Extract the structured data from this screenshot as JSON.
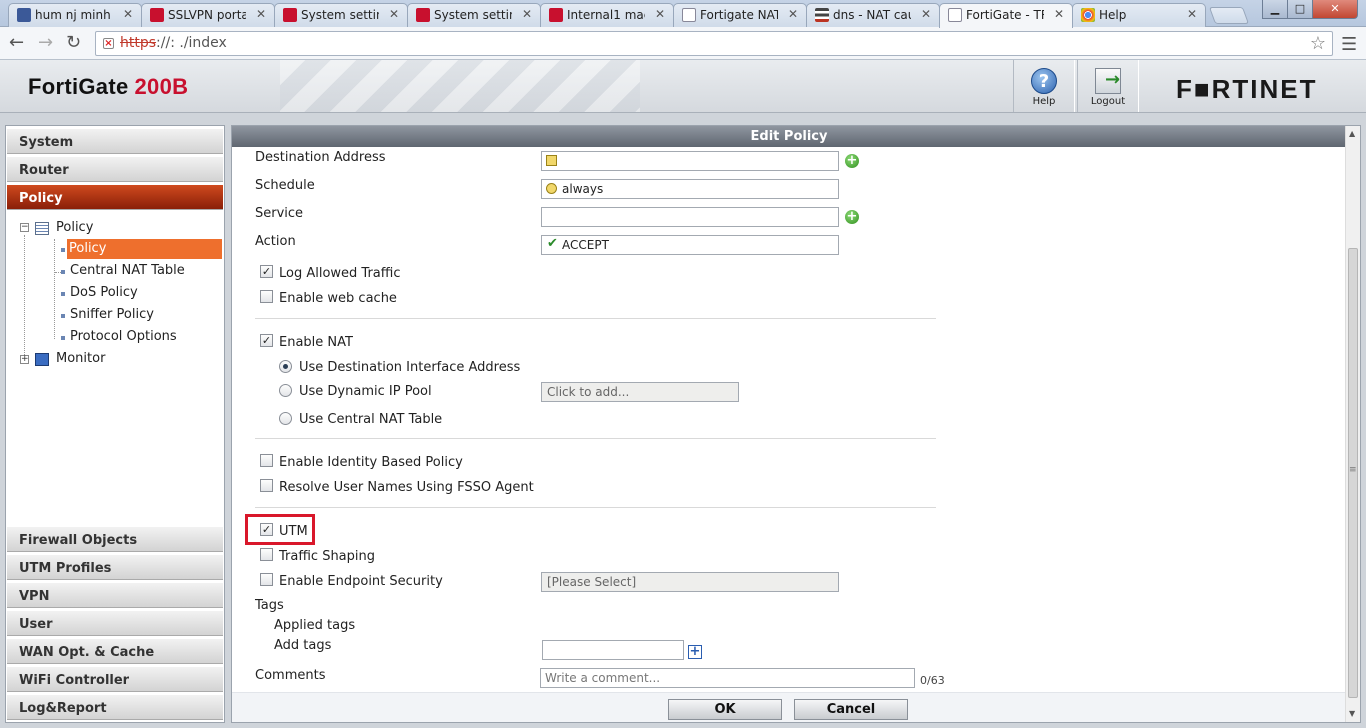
{
  "browser": {
    "tabs": [
      {
        "title": "hum nj minh c",
        "favicon": "facebook-icon"
      },
      {
        "title": "SSLVPN portal",
        "favicon": "fortinet-icon"
      },
      {
        "title": "System setting",
        "favicon": "fortinet-icon"
      },
      {
        "title": "System setting",
        "favicon": "fortinet-icon"
      },
      {
        "title": "Internal1 mac",
        "favicon": "fortinet-icon"
      },
      {
        "title": "Fortigate NAT",
        "favicon": "document-icon"
      },
      {
        "title": "dns - NAT cau",
        "favicon": "stackexchange-icon"
      },
      {
        "title": "FortiGate - TR",
        "favicon": "document-icon",
        "active": true
      },
      {
        "title": "Help",
        "favicon": "chrome-icon"
      }
    ],
    "tab_close": "✕",
    "address": {
      "scheme": "https",
      "rest": "://:                    ./index"
    },
    "window_controls": {
      "minimize": "▁",
      "maximize": "□",
      "close": "✕"
    }
  },
  "header": {
    "product": "FortiGate",
    "model": "200B",
    "help_label": "Help",
    "help_glyph": "?",
    "logout_label": "Logout",
    "brand": "F■RTINET"
  },
  "sidebar": {
    "categories_top": [
      "System",
      "Router",
      "Policy"
    ],
    "active_category": "Policy",
    "tree": {
      "group": "Policy",
      "items": [
        "Policy",
        "Central NAT Table",
        "DoS Policy",
        "Sniffer Policy",
        "Protocol Options"
      ],
      "selected": "Policy",
      "collapsed_group": "Monitor"
    },
    "categories_bottom": [
      "Firewall Objects",
      "UTM Profiles",
      "VPN",
      "User",
      "WAN Opt. & Cache",
      "WiFi Controller",
      "Log&Report"
    ]
  },
  "form": {
    "title": "Edit Policy",
    "destination_address": {
      "label": "Destination Address",
      "value": ""
    },
    "schedule": {
      "label": "Schedule",
      "value": "always"
    },
    "service": {
      "label": "Service",
      "value": ""
    },
    "action": {
      "label": "Action",
      "value": "ACCEPT"
    },
    "log_allowed_traffic": {
      "label": "Log Allowed Traffic",
      "checked": true
    },
    "enable_web_cache": {
      "label": "Enable web cache",
      "checked": false
    },
    "enable_nat": {
      "label": "Enable NAT",
      "checked": true
    },
    "nat_options": {
      "use_destination_interface": {
        "label": "Use Destination Interface Address",
        "selected": true
      },
      "use_dynamic_ip_pool": {
        "label": "Use Dynamic IP Pool",
        "selected": false,
        "placeholder": "Click to add..."
      },
      "use_central_nat_table": {
        "label": "Use Central NAT Table",
        "selected": false
      }
    },
    "enable_identity_based_policy": {
      "label": "Enable Identity Based Policy",
      "checked": false
    },
    "resolve_user_names": {
      "label": "Resolve User Names Using FSSO Agent",
      "checked": false
    },
    "utm": {
      "label": "UTM",
      "checked": true,
      "highlight_color": "#d9172a"
    },
    "traffic_shaping": {
      "label": "Traffic Shaping",
      "checked": false
    },
    "enable_endpoint_security": {
      "label": "Enable Endpoint Security",
      "checked": false,
      "select_value": "[Please Select]"
    },
    "tags": {
      "label": "Tags",
      "applied_label": "Applied tags",
      "add_label": "Add tags"
    },
    "comments": {
      "label": "Comments",
      "placeholder": "Write a comment...",
      "counter": "0/63"
    },
    "buttons": {
      "ok": "OK",
      "cancel": "Cancel"
    }
  },
  "colors": {
    "policy_active": "#b8320f",
    "selected_item": "#ee6f2d",
    "brand_red": "#c8102e"
  }
}
